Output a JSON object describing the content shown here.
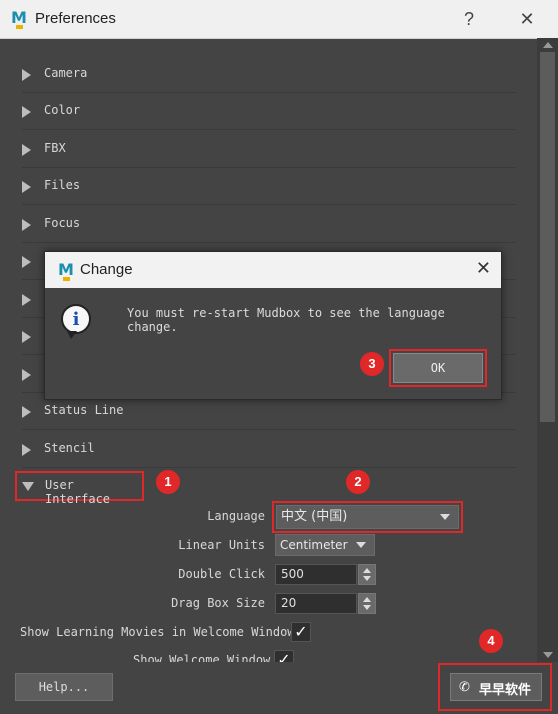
{
  "window": {
    "title": "Preferences",
    "help_glyph": "?",
    "close_glyph": "✕"
  },
  "sections": [
    {
      "label": "Camera"
    },
    {
      "label": "Color"
    },
    {
      "label": "FBX"
    },
    {
      "label": "Files"
    },
    {
      "label": "Focus"
    },
    {
      "label": "Status Line"
    },
    {
      "label": "Stencil"
    }
  ],
  "user_interface": {
    "label": "User Interface",
    "language": {
      "label": "Language",
      "value": "中文 (中国)"
    },
    "linear_units": {
      "label": "Linear Units",
      "value": "Centimeter"
    },
    "double_click": {
      "label": "Double Click",
      "value": "500"
    },
    "drag_box_size": {
      "label": "Drag Box Size",
      "value": "20"
    },
    "show_learning_movies": {
      "label": "Show Learning Movies in Welcome Window",
      "checked": true,
      "mark": "✓"
    },
    "show_welcome_window": {
      "label": "Show Welcome Window",
      "checked": true,
      "mark": "✓"
    }
  },
  "footer": {
    "help_label": "Help..."
  },
  "dialog": {
    "title": "Change",
    "close_glyph": "✕",
    "message": "You must re-start Mudbox to see the language change.",
    "ok_label": "OK",
    "info_glyph": "i"
  },
  "annotations": [
    "1",
    "2",
    "3",
    "4"
  ],
  "watermark": {
    "text": "早早软件",
    "icon": "wechat-icon",
    "glyph": "✆"
  },
  "logo_letter": "M",
  "colors": {
    "highlight": "#e12828",
    "panel": "#444444",
    "logo": "#1a8fb0"
  }
}
